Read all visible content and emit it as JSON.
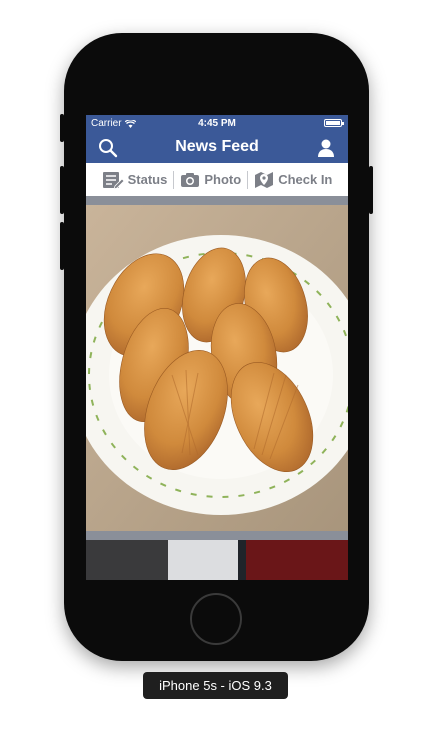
{
  "status_bar": {
    "carrier": "Carrier",
    "time": "4:45 PM"
  },
  "nav": {
    "title": "News Feed",
    "left_icon": "search-icon",
    "right_icon": "profile-icon"
  },
  "actions": [
    {
      "label": "Status",
      "icon": "status-icon"
    },
    {
      "label": "Photo",
      "icon": "camera-icon"
    },
    {
      "label": "Check In",
      "icon": "map-pin-icon"
    }
  ],
  "caption": "iPhone 5s - iOS 9.3",
  "colors": {
    "brand": "#3b5998",
    "feed_bg": "#8a8f99",
    "action_text": "#7c7f87"
  }
}
